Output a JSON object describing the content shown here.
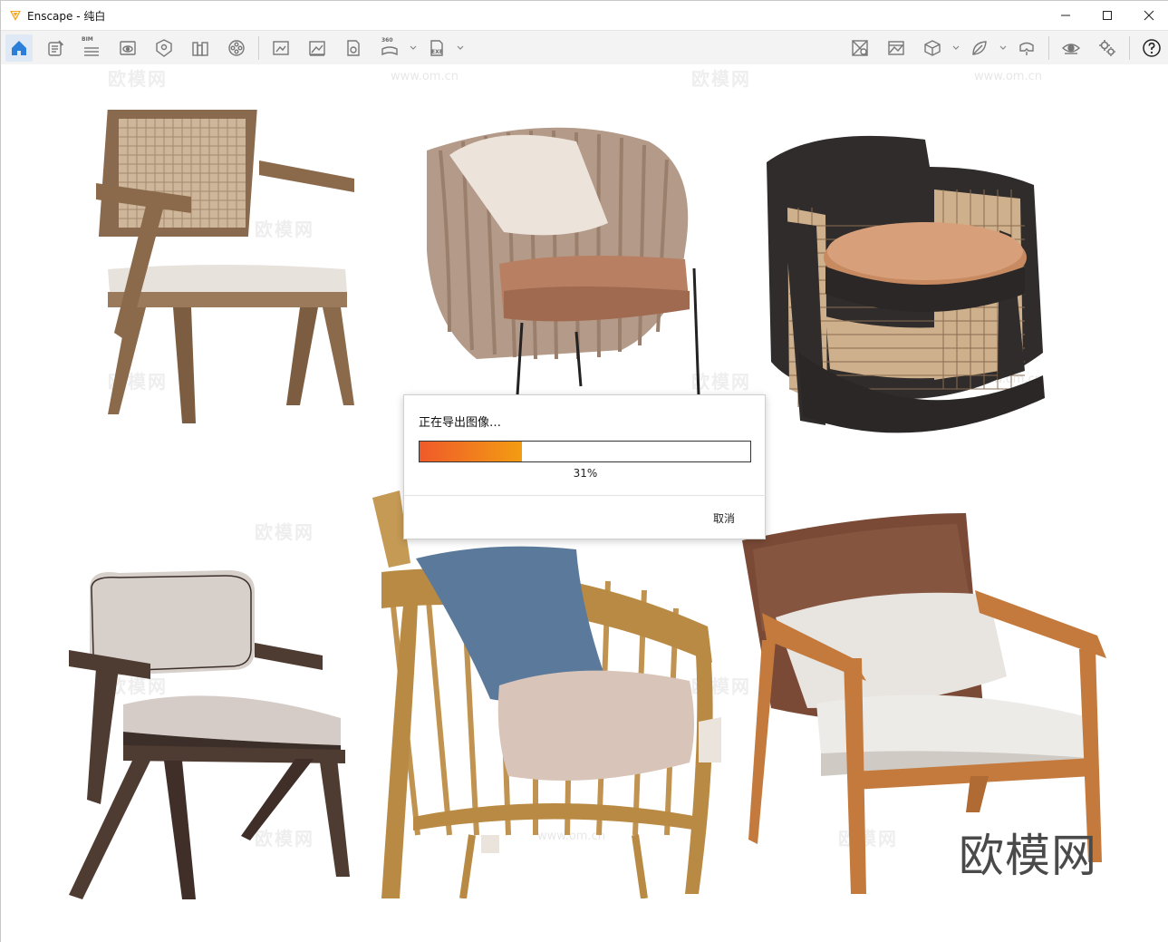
{
  "window": {
    "app_name": "Enscape",
    "separator": " - ",
    "document": "纯白",
    "title": "Enscape - 纯白"
  },
  "toolbar": {
    "tiny_labels": {
      "bim": "BIM",
      "pano": "360",
      "exe": "EXE"
    },
    "left_icons": [
      "home-icon",
      "notes-icon",
      "bim-icon",
      "view-icon",
      "sun-icon",
      "library-icon",
      "reel-icon"
    ],
    "mid_icons": [
      "screenshot-icon",
      "image-icon",
      "batch-icon",
      "panorama-icon",
      "exe-export-icon"
    ],
    "right_icons": [
      "material-icon",
      "atmosphere-icon",
      "cube-icon",
      "leaf-icon",
      "vr-icon",
      "eye-icon",
      "settings-icon",
      "help-icon"
    ]
  },
  "viewport": {
    "watermarks": [
      "欧模网",
      "www.om.cn"
    ],
    "brand_watermark": "欧模网"
  },
  "export_dialog": {
    "title": "正在导出图像…",
    "progress_percent": 31,
    "progress_text": "31%",
    "cancel_label": "取消",
    "colors": {
      "progress_start": "#ef5a2a",
      "progress_end": "#f39c12"
    }
  },
  "colors": {
    "accent": "#2b7fd9",
    "logo": "#f5a623"
  }
}
